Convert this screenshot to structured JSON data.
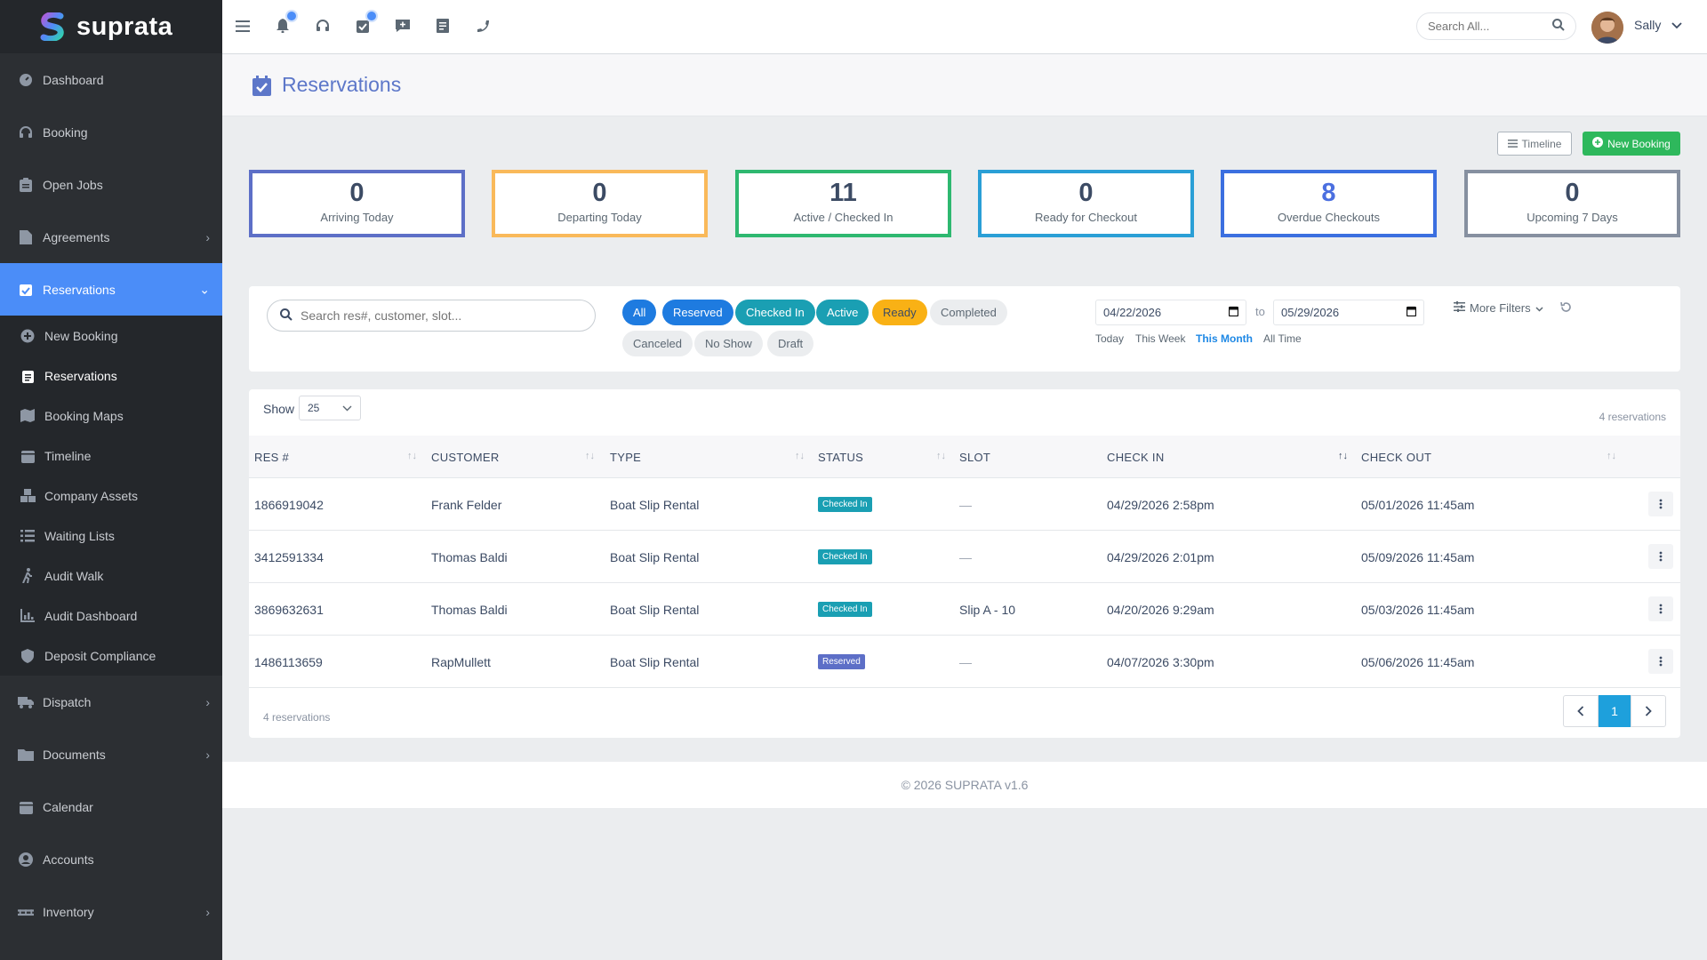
{
  "brand": {
    "name": "suprata"
  },
  "sidebar": {
    "items": [
      {
        "label": "Dashboard",
        "icon": "gauge-icon"
      },
      {
        "label": "Booking",
        "icon": "headset-icon"
      },
      {
        "label": "Open Jobs",
        "icon": "clipboard-icon"
      },
      {
        "label": "Agreements",
        "icon": "file-icon"
      },
      {
        "label": "Reservations",
        "icon": "calendar-check-icon"
      }
    ],
    "sub_items": [
      {
        "label": "New Booking",
        "icon": "plus-circle-icon"
      },
      {
        "label": "Reservations",
        "icon": "clipboard-list-icon"
      },
      {
        "label": "Booking Maps",
        "icon": "map-icon"
      },
      {
        "label": "Timeline",
        "icon": "calendar-icon"
      },
      {
        "label": "Company Assets",
        "icon": "boxes-icon"
      },
      {
        "label": "Waiting Lists",
        "icon": "list-icon"
      },
      {
        "label": "Audit Walk",
        "icon": "walking-icon"
      },
      {
        "label": "Audit Dashboard",
        "icon": "chart-icon"
      },
      {
        "label": "Deposit Compliance",
        "icon": "shield-icon"
      }
    ],
    "bottom_items": [
      {
        "label": "Dispatch",
        "icon": "truck-icon"
      },
      {
        "label": "Documents",
        "icon": "folder-icon"
      },
      {
        "label": "Calendar",
        "icon": "calendar-icon"
      },
      {
        "label": "Accounts",
        "icon": "user-circle-icon"
      },
      {
        "label": "Inventory",
        "icon": "pallet-icon"
      }
    ]
  },
  "header": {
    "search_placeholder": "Search All...",
    "user_name": "Sally"
  },
  "page": {
    "title": "Reservations"
  },
  "toolbar": {
    "timeline_label": "Timeline",
    "new_booking_label": "New Booking"
  },
  "stats": [
    {
      "value": "0",
      "label": "Arriving Today",
      "color": "#5d6fc7"
    },
    {
      "value": "0",
      "label": "Departing Today",
      "color": "#f9b95a"
    },
    {
      "value": "11",
      "label": "Active / Checked In",
      "color": "#2eb870"
    },
    {
      "value": "0",
      "label": "Ready for Checkout",
      "color": "#2a9fd6"
    },
    {
      "value": "8",
      "label": "Overdue Checkouts",
      "color": "#3b6fe0"
    },
    {
      "value": "0",
      "label": "Upcoming 7 Days",
      "color": "#8690a0"
    }
  ],
  "filters": {
    "search_placeholder": "Search res#, customer, slot...",
    "status_pills": [
      "All",
      "Reserved",
      "Checked In",
      "Active",
      "Ready",
      "Completed",
      "Canceled",
      "No Show",
      "Draft"
    ],
    "date_from": "04/22/2026",
    "date_to": "05/29/2026",
    "to_label": "to",
    "quick_ranges": [
      "Today",
      "This Week",
      "This Month",
      "All Time"
    ],
    "more_filters_label": "More Filters"
  },
  "table": {
    "show_label": "Show",
    "page_size": "25",
    "count_text": "4 reservations",
    "columns": [
      "RES #",
      "CUSTOMER",
      "TYPE",
      "STATUS",
      "SLOT",
      "CHECK IN",
      "CHECK OUT"
    ],
    "rows": [
      {
        "res": "1866919042",
        "customer": "Frank Felder",
        "type": "Boat Slip Rental",
        "status": "Checked In",
        "slot": "—",
        "check_in": "04/29/2026 2:58pm",
        "check_out": "05/01/2026 11:45am"
      },
      {
        "res": "3412591334",
        "customer": "Thomas Baldi",
        "type": "Boat Slip Rental",
        "status": "Checked In",
        "slot": "—",
        "check_in": "04/29/2026 2:01pm",
        "check_out": "05/09/2026 11:45am"
      },
      {
        "res": "3869632631",
        "customer": "Thomas Baldi",
        "type": "Boat Slip Rental",
        "status": "Checked In",
        "slot": "Slip A - 10",
        "check_in": "04/20/2026 9:29am",
        "check_out": "05/03/2026 11:45am"
      },
      {
        "res": "1486113659",
        "customer": "RapMullett",
        "type": "Boat Slip Rental",
        "status": "Reserved",
        "slot": "—",
        "check_in": "04/07/2026 3:30pm",
        "check_out": "05/06/2026 11:45am"
      }
    ],
    "current_page": "1"
  },
  "footer": {
    "text": "© 2026 SUPRATA v1.6"
  }
}
